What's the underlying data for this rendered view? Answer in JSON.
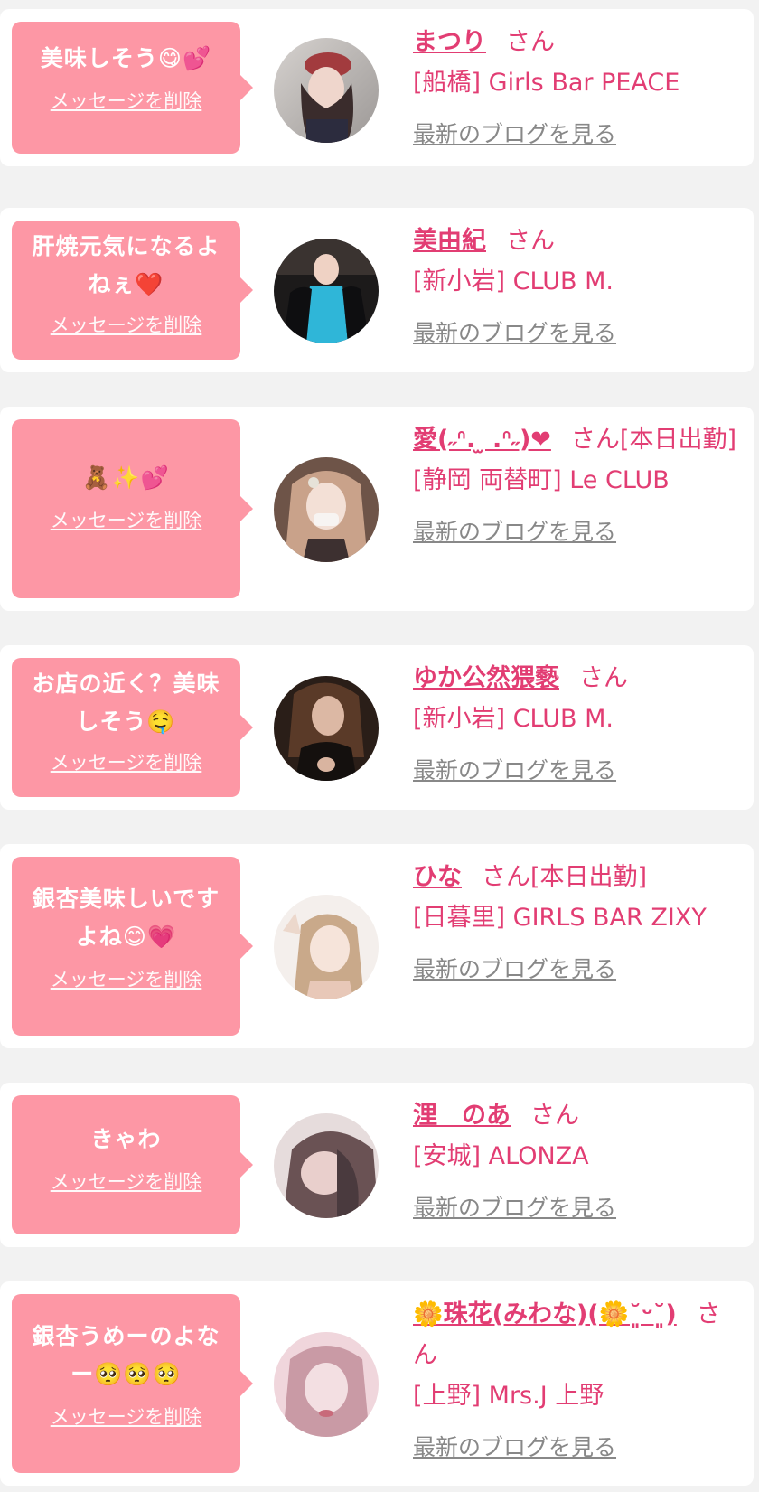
{
  "ui": {
    "delete_label": "メッセージを削除",
    "blog_label": "最新のブログを見る",
    "honorific": "さん"
  },
  "messages": [
    {
      "text": "美味しそう😋💕",
      "name": "まつり",
      "suffix": "",
      "shop": "[船橋] Girls Bar PEACE",
      "avatar_colors": [
        "#bfb9b8",
        "#7a4a4a",
        "#2c2c3e"
      ]
    },
    {
      "text": "肝焼元気になるよねぇ❤️",
      "name": "美由紀",
      "suffix": "",
      "shop": "[新小岩] CLUB M.",
      "avatar_colors": [
        "#2a2a2a",
        "#2fb6d8",
        "#0e0e10"
      ]
    },
    {
      "text": "🧸✨💕",
      "name": "愛(˶ᐢ. ̫ .ᐢ˶)❤︎",
      "suffix": "[本日出勤]",
      "shop": "[静岡 両替町] Le CLUB",
      "avatar_colors": [
        "#c9a28a",
        "#f1e0d4",
        "#3d3030"
      ]
    },
    {
      "text": "お店の近く？美味しそう🤤",
      "name": "ゆか公然猥褻",
      "suffix": "",
      "shop": "[新小岩] CLUB M.",
      "avatar_colors": [
        "#3a2a22",
        "#d9b4a0",
        "#14100e"
      ]
    },
    {
      "text": "銀杏美味しいですよね😊💗",
      "name": "ひな",
      "suffix": "[本日出勤]",
      "shop": "[日暮里] GIRLS BAR ZIXY",
      "avatar_colors": [
        "#f4efec",
        "#e8c8b8",
        "#c9a98a"
      ]
    },
    {
      "text": "きゃわ",
      "name": "浬　のあ",
      "suffix": "",
      "shop": "[安城] ALONZA",
      "avatar_colors": [
        "#e6dcdc",
        "#a88a8a",
        "#4a3a3e"
      ]
    },
    {
      "text": "銀杏うめーのよなー🥺🥺🥺",
      "name": "🌼珠花(みわな)(🌼˘͈ᵕ˘͈)",
      "suffix": "",
      "shop": "[上野] Mrs.J 上野",
      "avatar_colors": [
        "#f0d6dc",
        "#c99aa5",
        "#d8b4bb"
      ]
    }
  ],
  "colors": {
    "bubble": "#fd97a5",
    "accent": "#e23d73",
    "link_gray": "#888888",
    "background": "#f2f2f2"
  }
}
